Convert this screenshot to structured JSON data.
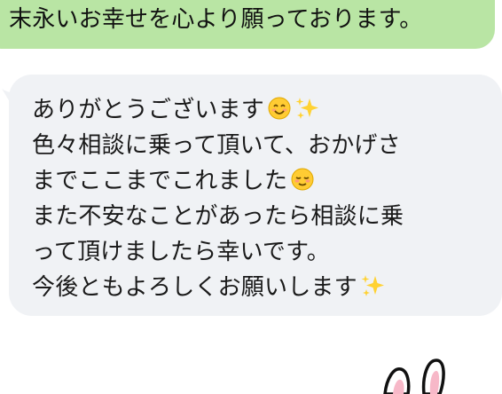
{
  "sent_message": {
    "text": "末永いお幸せを心より願っております。"
  },
  "received_message": {
    "lines": [
      {
        "text": "ありがとうございます",
        "emoji": [
          "smiling-face-icon",
          "sparkles-icon"
        ]
      },
      {
        "text": "色々相談に乗って頂いて、おかげさ",
        "emoji": []
      },
      {
        "text": "までここまでこれました",
        "emoji": [
          "relieved-face-icon"
        ]
      },
      {
        "text": "また不安なことがあったら相談に乗",
        "emoji": []
      },
      {
        "text": "って頂けましたら幸いです。",
        "emoji": []
      },
      {
        "text": "今後ともよろしくお願いします",
        "emoji": [
          "sparkles-icon"
        ]
      }
    ]
  },
  "sticker": {
    "icon": "bunny-ears-sticker-icon"
  },
  "colors": {
    "sent_bubble": "#b9e5a4",
    "received_bubble": "#f0f2f5",
    "text": "#1a1a1a",
    "background": "#ffffff"
  }
}
